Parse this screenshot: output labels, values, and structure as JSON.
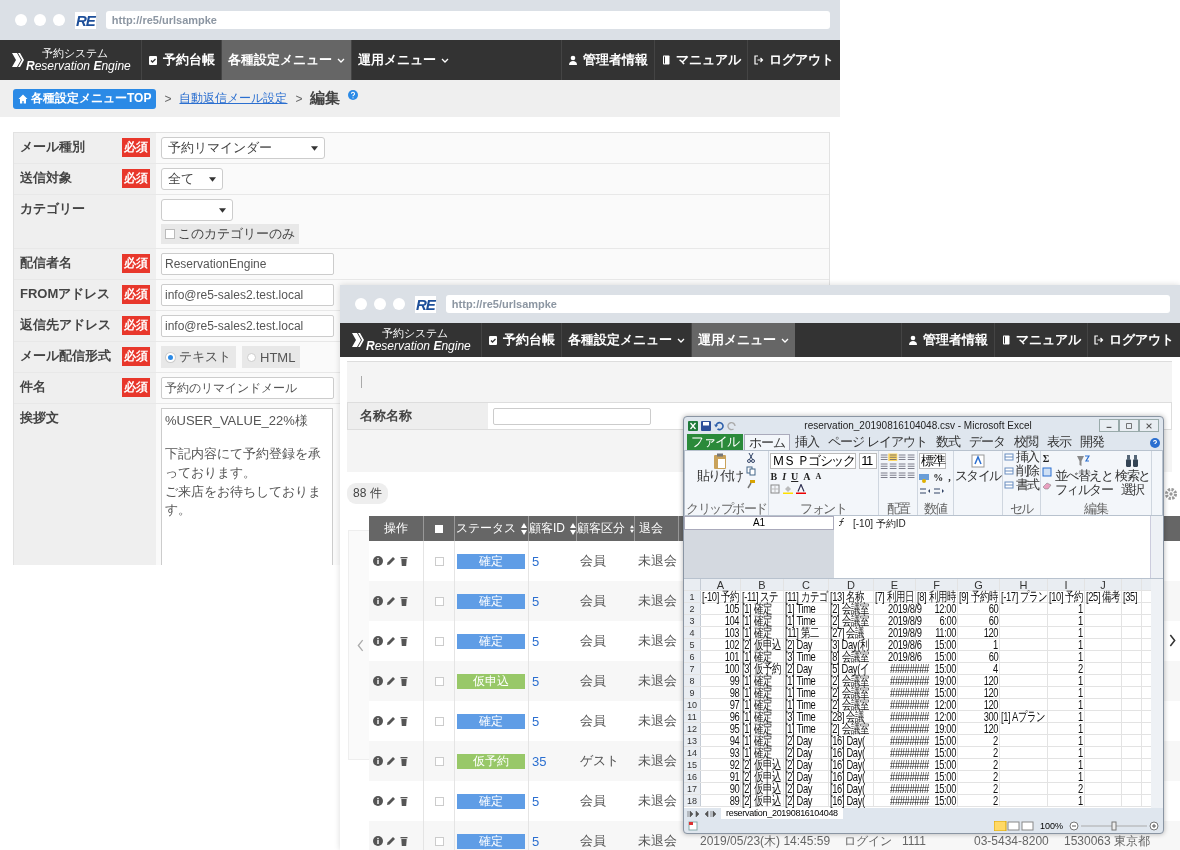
{
  "back_window": {
    "browser": {
      "favicon": "RE",
      "url": "http://re5/urlsampke"
    },
    "nav": {
      "logo": {
        "tagline": "予約システム",
        "name": "**R**eservation **E**ngine"
      },
      "left": [
        {
          "label": "予約台帳",
          "dropdown": false,
          "selected": false
        },
        {
          "label": "各種設定メニュー",
          "dropdown": true,
          "selected": true
        },
        {
          "label": "運用メニュー",
          "dropdown": true,
          "selected": false
        }
      ],
      "right": [
        {
          "label": "管理者情報"
        },
        {
          "label": "マニュアル"
        },
        {
          "label": "ログアウト"
        }
      ]
    },
    "breadcrumb": {
      "home": "各種設定メニューTOP",
      "sep": ">",
      "link": "自動返信メール設定",
      "sep2": ">",
      "current": "編集"
    },
    "form": [
      {
        "kind": "select",
        "label": "メール種別",
        "badge": "必須",
        "value": "予約リマインダー"
      },
      {
        "kind": "select",
        "label": "送信対象",
        "badge": "必須",
        "value": "全て"
      },
      {
        "kind": "category",
        "label": "カテゴリー",
        "check": {
          "label": "このカテゴリーのみ",
          "checked": false
        }
      },
      {
        "kind": "text",
        "label": "配信者名",
        "badge": "必須",
        "value": "ReservationEngine"
      },
      {
        "kind": "text",
        "label": "FROMアドレス",
        "badge": "必須",
        "value": "info@re5-sales2.test.local"
      },
      {
        "kind": "text",
        "label": "返信先アドレス",
        "badge": "必須",
        "value": "info@re5-sales2.test.local"
      },
      {
        "kind": "radio",
        "label": "メール配信形式",
        "badge": "必須",
        "options": [
          {
            "label": "テキスト",
            "selected": true
          },
          {
            "label": "HTML",
            "selected": false
          }
        ]
      },
      {
        "kind": "text",
        "label": "件名",
        "badge": "必須",
        "value": "予約のリマインドメール"
      },
      {
        "kind": "textarea",
        "label": "挨拶文",
        "paragraphs": [
          [
            "%USER_VALUE_22%様"
          ],
          [
            "下記内容にて予約登録を承っております。",
            "ご来店をお待ちしております。"
          ]
        ]
      }
    ]
  },
  "front_window": {
    "browser": {
      "favicon": "RE",
      "url": "http://re5/urlsampke"
    },
    "nav": {
      "logo": {
        "tagline": "予約システム",
        "name": "**R**eservation **E**ngine"
      },
      "left": [
        {
          "label": "予約台帳",
          "dropdown": false,
          "selected": false
        },
        {
          "label": "各種設定メニュー",
          "dropdown": true,
          "selected": false
        },
        {
          "label": "運用メニュー",
          "dropdown": true,
          "selected": true
        }
      ],
      "right": [
        {
          "label": "管理者情報"
        },
        {
          "label": "マニュアル"
        },
        {
          "label": "ログアウト"
        }
      ]
    },
    "search": {
      "label": "名称名称"
    },
    "count": "88 件",
    "table": {
      "select_all_checked": false,
      "columns": [
        "操作",
        "ステータス",
        "顧客ID",
        "顧客区分",
        "退会"
      ],
      "rows": [
        {
          "checked": false,
          "status": "確定",
          "color": "#5f9de6",
          "id": "5",
          "type": "会員",
          "left": "未退会"
        },
        {
          "checked": false,
          "status": "確定",
          "color": "#5f9de6",
          "id": "5",
          "type": "会員",
          "left": "未退会"
        },
        {
          "checked": false,
          "status": "確定",
          "color": "#5f9de6",
          "id": "5",
          "type": "会員",
          "left": "未退会"
        },
        {
          "checked": false,
          "status": "仮申込",
          "color": "#98c868",
          "id": "5",
          "type": "会員",
          "left": "未退会"
        },
        {
          "checked": false,
          "status": "確定",
          "color": "#5f9de6",
          "id": "5",
          "type": "会員",
          "left": "未退会"
        },
        {
          "checked": false,
          "status": "仮予約",
          "color": "#98c868",
          "id": "35",
          "type": "ゲスト",
          "left": "未退会"
        },
        {
          "checked": false,
          "status": "確定",
          "color": "#5f9de6",
          "id": "5",
          "type": "会員",
          "left": "未退会"
        },
        {
          "checked": false,
          "status": "確定",
          "color": "#5f9de6",
          "id": "5",
          "type": "会員",
          "left": "未退会",
          "more": [
            "2019/05/23(木) 14:45:59",
            "ログイン",
            "1111",
            "03-5434-8200",
            "1530063 東京都"
          ]
        }
      ]
    }
  },
  "excel": {
    "title": "reservation_20190816104048.csv - Microsoft Excel",
    "tabs": [
      {
        "label": "ファイル",
        "kind": "file",
        "selected": false
      },
      {
        "label": "ホーム",
        "selected": true
      },
      {
        "label": "挿入",
        "selected": false
      },
      {
        "label": "ページ レイアウト",
        "selected": false
      },
      {
        "label": "数式",
        "selected": false
      },
      {
        "label": "データ",
        "selected": false
      },
      {
        "label": "校閲",
        "selected": false
      },
      {
        "label": "表示",
        "selected": false
      },
      {
        "label": "開発",
        "selected": false
      }
    ],
    "ribbon": [
      {
        "kind": "clipboard",
        "label": "クリップボード",
        "paste": "貼り付け"
      },
      {
        "kind": "font",
        "label": "フォント",
        "font": "ＭＳ Ｐゴシック",
        "size": "11",
        "buttons": [
          "B",
          "I",
          "U",
          "A",
          "A"
        ]
      },
      {
        "kind": "alignment",
        "label": "配置"
      },
      {
        "kind": "number",
        "label": "数値",
        "format": "標準",
        "buttons": [
          "%",
          ","
        ]
      },
      {
        "kind": "styles",
        "button": "スタイル"
      },
      {
        "kind": "cells",
        "label": "セル",
        "buttons": [
          "挿入",
          "削除",
          "書式"
        ]
      },
      {
        "kind": "editing",
        "label": "編集",
        "sum": "Σ",
        "buttons": [
          {
            "lines": [
              "並べ替えと",
              "フィルター"
            ]
          },
          {
            "lines": [
              "検索と",
              "選択"
            ]
          }
        ]
      }
    ],
    "name_box": "A1",
    "formula": "[-10] 予約ID",
    "columns": [
      "A",
      "B",
      "C",
      "D",
      "E",
      "F",
      "G",
      "H",
      "I",
      "J"
    ],
    "rows": [
      {
        "num": "1",
        "cells": [
          "[-10] 予約",
          "[-11] ステ",
          "[11] カテゴ",
          "[13] 名称",
          "[7] 利用日",
          "[8] 利用時",
          "[9] 予約時",
          "[-17] プラン",
          "[10] 予約",
          "[25] 備考",
          "[35]"
        ]
      },
      {
        "num": "2",
        "cells": [
          "105",
          "[1] 確定",
          "[1] Time",
          "[2] 会議室",
          "2019/8/9",
          "12:00",
          "60",
          null,
          "1"
        ]
      },
      {
        "num": "3",
        "cells": [
          "104",
          "[1] 確定",
          "[1] Time",
          "[2] 会議室",
          "2019/8/9",
          "6:00",
          "60",
          null,
          "1"
        ]
      },
      {
        "num": "4",
        "cells": [
          "103",
          "[1] 確定",
          "[11] 第二",
          "[27] 会議",
          "2019/8/9",
          "11:00",
          "120",
          null,
          "1"
        ]
      },
      {
        "num": "5",
        "cells": [
          "102",
          "[2] 仮申込",
          "[2] Day",
          "[3] Day(利",
          "2019/8/6",
          "15:00",
          "1",
          null,
          "1"
        ]
      },
      {
        "num": "6",
        "cells": [
          "101",
          "[1] 確定",
          "[3] Time",
          "[8] 会議室",
          "2019/8/6",
          "15:00",
          "60",
          null,
          "1"
        ]
      },
      {
        "num": "7",
        "cells": [
          "100",
          "[3] 仮予約",
          "[2] Day",
          "[5] Day(イ",
          "########",
          "15:00",
          "4",
          null,
          "2"
        ]
      },
      {
        "num": "8",
        "cells": [
          "99",
          "[1] 確定",
          "[1] Time",
          "[2] 会議室",
          "########",
          "19:00",
          "120",
          null,
          "1"
        ]
      },
      {
        "num": "9",
        "cells": [
          "98",
          "[1] 確定",
          "[1] Time",
          "[2] 会議室",
          "########",
          "15:00",
          "120",
          null,
          "1"
        ]
      },
      {
        "num": "10",
        "cells": [
          "97",
          "[1] 確定",
          "[1] Time",
          "[2] 会議室",
          "########",
          "12:00",
          "120",
          null,
          "1"
        ]
      },
      {
        "num": "11",
        "cells": [
          "96",
          "[1] 確定",
          "[3] Time",
          "[28] 会議",
          "########",
          "12:00",
          "300",
          "[1] Aプラン",
          "1"
        ]
      },
      {
        "num": "12",
        "cells": [
          "95",
          "[1] 確定",
          "[1] Time",
          "[2] 会議室",
          "########",
          "19:00",
          "120",
          null,
          "1"
        ]
      },
      {
        "num": "13",
        "cells": [
          "94",
          "[1] 確定",
          "[2] Day",
          "[16] Day(",
          "########",
          "15:00",
          "2",
          null,
          "1"
        ]
      },
      {
        "num": "14",
        "cells": [
          "93",
          "[1] 確定",
          "[2] Day",
          "[16] Day(",
          "########",
          "15:00",
          "2",
          null,
          "1"
        ]
      },
      {
        "num": "15",
        "cells": [
          "92",
          "[2] 仮申込",
          "[2] Day",
          "[16] Day(",
          "########",
          "15:00",
          "2",
          null,
          "1"
        ]
      },
      {
        "num": "16",
        "cells": [
          "91",
          "[2] 仮申込",
          "[2] Day",
          "[16] Day(",
          "########",
          "15:00",
          "2",
          null,
          "1"
        ]
      },
      {
        "num": "17",
        "cells": [
          "90",
          "[2] 仮申込",
          "[2] Day",
          "[16] Day(",
          "########",
          "15:00",
          "2",
          null,
          "2"
        ]
      },
      {
        "num": "18",
        "cells": [
          "89",
          "[2] 仮申込",
          "[2] Day",
          "[16] Day(",
          "########",
          "15:00",
          "2",
          null,
          "1"
        ]
      }
    ],
    "sheet": "reservation_20190816104048",
    "zoom": "100%",
    "zoom_slider": {
      "level": 0.5
    }
  }
}
